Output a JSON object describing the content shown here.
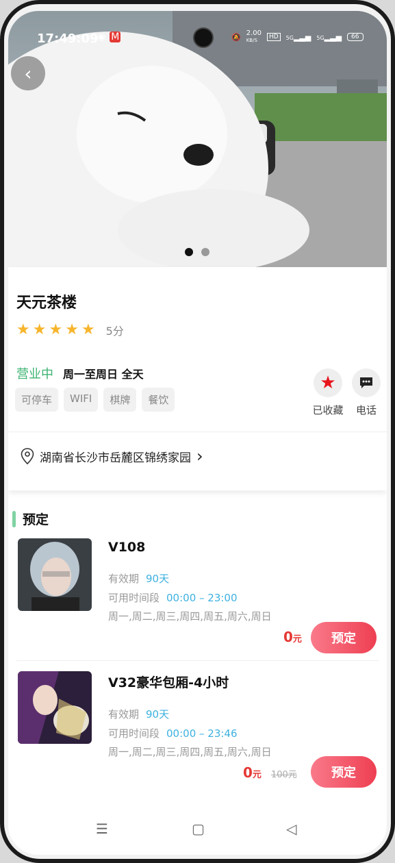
{
  "status_bar": {
    "time": "17:49:09",
    "speed": "2.00",
    "speed_unit": "KB/S",
    "hd": "HD",
    "net1": "5G",
    "net2": "5G",
    "battery": "66"
  },
  "hero": {
    "back_icon": "chevron-left-icon",
    "pages": 2,
    "active_page": 1
  },
  "shop": {
    "name": "天元茶楼",
    "rating": 5,
    "score_label": "5分",
    "status": "营业中",
    "hours": "周一至周日 全天",
    "tags": [
      "可停车",
      "WIFI",
      "棋牌",
      "餐饮"
    ],
    "favorite_label": "已收藏",
    "phone_label": "电话",
    "address": "湖南省长沙市岳麓区锦绣家园",
    "colors": {
      "open": "#3cb371",
      "star": "#f7b52c",
      "accent": "#e53935"
    }
  },
  "booking": {
    "title": "预定",
    "validity_label": "有效期",
    "time_label": "可用时间段",
    "items": [
      {
        "name": "V108",
        "validity": "90天",
        "time_range": "00:00 – 23:00",
        "days": "周一,周二,周三,周四,周五,周六,周日",
        "price": "0",
        "unit": "元",
        "original": "",
        "button": "预定"
      },
      {
        "name": "V32豪华包厢-4小时",
        "validity": "90天",
        "time_range": "00:00 – 23:46",
        "days": "周一,周二,周三,周四,周五,周六,周日",
        "price": "0",
        "unit": "元",
        "original": "100元",
        "button": "预定"
      }
    ]
  },
  "nav": {
    "menu_icon": "menu-icon",
    "home_icon": "home-square-icon",
    "back_icon": "back-triangle-icon"
  }
}
